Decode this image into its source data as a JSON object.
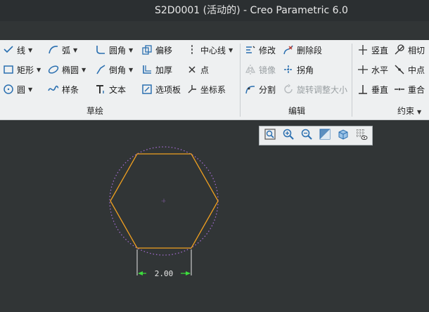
{
  "window": {
    "title": "S2D0001 (活动的) - Creo Parametric 6.0"
  },
  "ribbon": {
    "sketch_group": {
      "label": "草绘",
      "line": "线",
      "arc": "弧",
      "fillet": "圆角",
      "offset": "偏移",
      "centerline": "中心线",
      "rectangle": "矩形",
      "ellipse": "椭圆",
      "chamfer": "倒角",
      "thicken": "加厚",
      "point": "点",
      "circle": "圆",
      "spline": "样条",
      "text": "文本",
      "palette": "选项板",
      "coord_sys": "坐标系"
    },
    "edit_group": {
      "label": "编辑",
      "modify": "修改",
      "delete_segment": "删除段",
      "mirror": "镜像",
      "corner": "拐角",
      "divide": "分割",
      "rotate_resize": "旋转调整大小"
    },
    "constrain_group": {
      "label": "约束",
      "vertical": "竖直",
      "tangent": "相切",
      "horizontal": "水平",
      "midpoint": "中点",
      "perpendicular": "垂直",
      "coincident": "重合"
    }
  },
  "view_toolbar": {
    "items": [
      "refit-icon",
      "zoom-in-icon",
      "zoom-out-icon",
      "repaint-icon",
      "view-orientation-icon",
      "sketcher-display-icon"
    ]
  },
  "sketch": {
    "shape": "hexagon",
    "dimension_text": "2.00"
  },
  "colors": {
    "background": "#313536",
    "ribbon": "#eef0f1",
    "geometry": "#f0a020",
    "construction": "#a06acd",
    "dimension": "#e8e8e8",
    "arrow": "#3ddc3d"
  }
}
